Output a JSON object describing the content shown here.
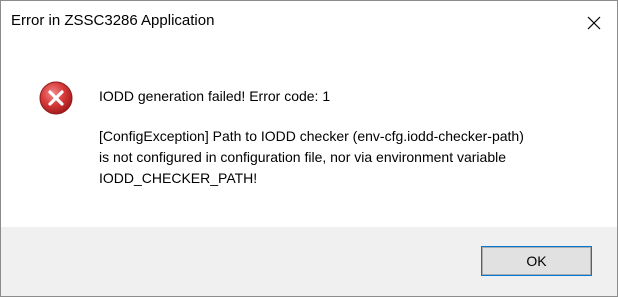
{
  "window": {
    "title": "Error in ZSSC3286 Application",
    "close_icon": "close-icon"
  },
  "message": {
    "icon": "error-icon",
    "title": "IODD generation failed! Error code: 1",
    "lines": [
      "[ConfigException] Path to IODD checker (env-cfg.iodd-checker-path)",
      "is not configured in configuration file, nor via environment variable",
      "IODD_CHECKER_PATH!"
    ]
  },
  "buttons": {
    "ok_label": "OK"
  },
  "colors": {
    "error_red": "#d83a3a",
    "footer_bg": "#f0f0f0",
    "button_bg": "#e1e1e1",
    "focus_blue": "#0078d7"
  }
}
